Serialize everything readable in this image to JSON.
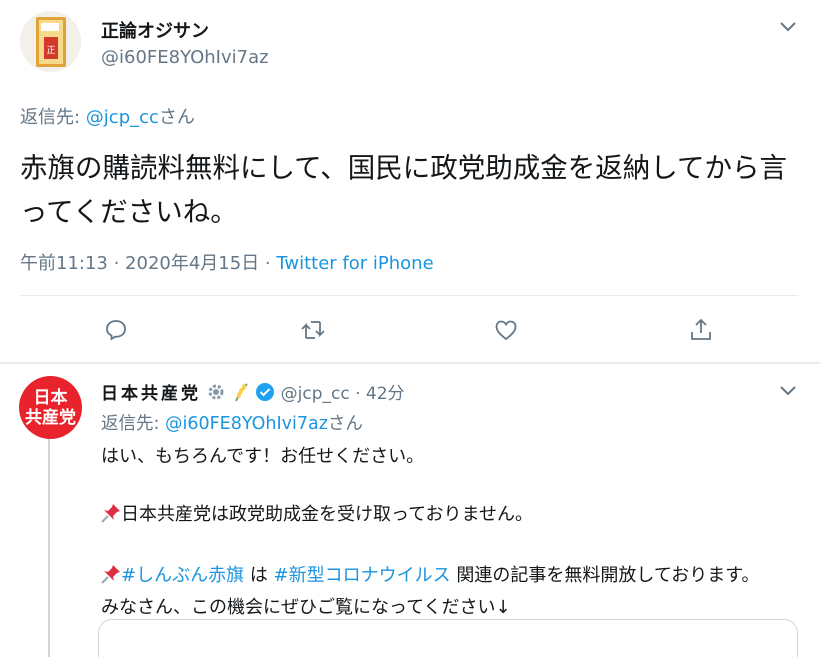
{
  "tweet_original": {
    "author_name": "正論オジサン",
    "author_handle": "@i60FE8YOhIvi7az",
    "reply_prefix": "返信先: ",
    "reply_to_handle": "@jcp_cc",
    "reply_suffix": "さん",
    "text": "赤旗の購読料無料にして、国民に政党助成金を返納してから言ってくださいね。",
    "timestamp": "午前11:13 · 2020年4月15日 · ",
    "source": "Twitter for iPhone",
    "actions": [
      "reply-icon",
      "retweet-icon",
      "like-icon",
      "share-icon"
    ]
  },
  "tweet_reply": {
    "author_name": "日本共産党",
    "author_handle": "@jcp_cc",
    "separator": "·",
    "time": "42分",
    "avatar_text_line1": "日本",
    "avatar_text_line2": "共産党",
    "reply_prefix": "返信先: ",
    "reply_to_handle": "@i60FE8YOhIvi7az",
    "reply_suffix": "さん",
    "line1": "はい、もちろんです！お任せください。",
    "line2": "日本共産党は政党助成金を受け取っておりません。",
    "line3_tag1": "#しんぶん赤旗",
    "line3_mid1": " は ",
    "line3_tag2": "#新型コロナウイルス",
    "line3_rest": " 関連の記事を無料開放しております。",
    "line4": "みなさん、この機会にぜひご覧になってください↓"
  },
  "colors": {
    "link": "#1b95e0",
    "secondary_text": "#657786",
    "party_red": "#e8232b",
    "verified": "#1da1f2"
  }
}
